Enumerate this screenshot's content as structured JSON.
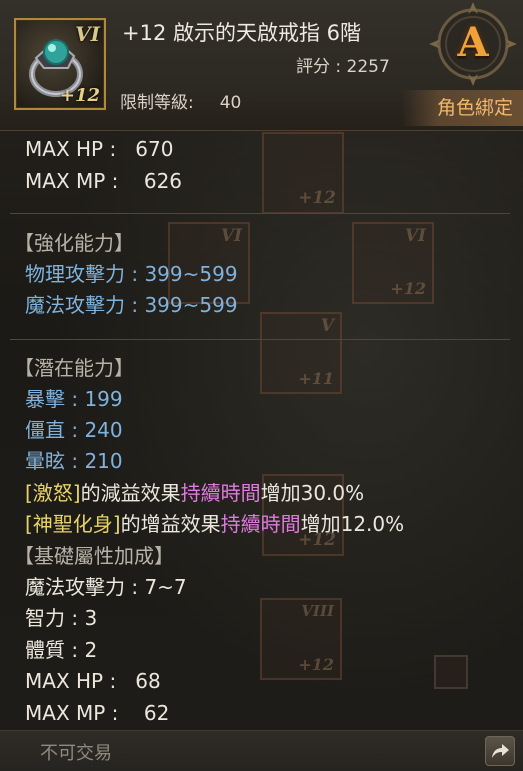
{
  "item": {
    "name": "+12 啟示的天啟戒指 6階",
    "tier_badge": "VI",
    "enhance_badge": "+12",
    "score": "評分 : 2257",
    "level_label": "限制等級:",
    "level_value": "40",
    "grade": "A",
    "bind": "角色綁定",
    "icon": "emerald-ring-icon"
  },
  "base_stats": [
    {
      "label": "MAX HP :",
      "value": "670"
    },
    {
      "label": "MAX MP :",
      "value": "626"
    }
  ],
  "enhance_section": {
    "title": "【強化能力】",
    "lines": [
      "物理攻擊力 : 399~599",
      "魔法攻擊力 : 399~599"
    ]
  },
  "potential_section": {
    "title": "【潛在能力】",
    "lines": [
      "暴擊 : 199",
      "僵直 : 240",
      "暈眩 : 210"
    ],
    "effects": [
      {
        "tag": "[激怒]",
        "mid": "的減益效果",
        "hl": "持續時間",
        "tail": "增加30.0%"
      },
      {
        "tag": "[神聖化身]",
        "mid": "的增益效果",
        "hl": "持續時間",
        "tail": "增加12.0%"
      }
    ]
  },
  "basic_section": {
    "title": "【基礎屬性加成】",
    "lines": [
      "魔法攻擊力 : 7~7",
      "智力 : 3",
      "體質 : 2"
    ],
    "max_hp": {
      "label": "MAX HP :",
      "value": "68"
    },
    "max_mp": {
      "label": "MAX MP :",
      "value": "62"
    }
  },
  "footer": {
    "trade": "不可交易",
    "share_icon": "share-arrow-icon"
  },
  "ghost_icons": [
    {
      "badge": "+12"
    },
    {
      "badge": "VI"
    },
    {
      "badge": "VI",
      "plus": "+12"
    },
    {
      "badge": "V",
      "plus": "+11"
    },
    {
      "badge": "+12"
    },
    {
      "badge": "VIII",
      "plus": "+12"
    }
  ],
  "colors": {
    "blue_stat": "#7fb2de",
    "yellow_tag": "#e8d36a",
    "pink_highlight": "#e07ae0",
    "grade_orange": "#f0a23a",
    "bind_orange": "#f0b96a"
  }
}
